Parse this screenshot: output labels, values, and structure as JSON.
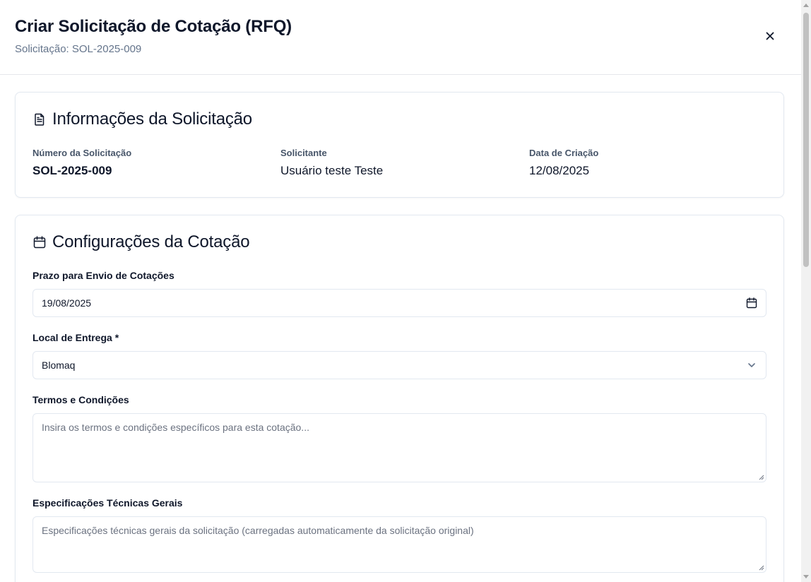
{
  "header": {
    "title": "Criar Solicitação de Cotação (RFQ)",
    "subtitle": "Solicitação: SOL-2025-009",
    "close_icon": "close-icon"
  },
  "info_card": {
    "icon": "document-icon",
    "title": "Informações da Solicitação",
    "fields": [
      {
        "label": "Número da Solicitação",
        "value": "SOL-2025-009"
      },
      {
        "label": "Solicitante",
        "value": "Usuário teste Teste"
      },
      {
        "label": "Data de Criação",
        "value": "12/08/2025"
      }
    ]
  },
  "config_card": {
    "icon": "calendar-icon",
    "title": "Configurações da Cotação",
    "deadline": {
      "label": "Prazo para Envio de Cotações",
      "value": "19/08/2025",
      "icon": "calendar-icon"
    },
    "delivery": {
      "label": "Local de Entrega *",
      "value": "Blomaq",
      "icon": "chevron-down-icon"
    },
    "terms": {
      "label": "Termos e Condições",
      "placeholder": "Insira os termos e condições específicos para esta cotação..."
    },
    "specs": {
      "label": "Especificações Técnicas Gerais",
      "placeholder": "Especificações técnicas gerais da solicitação (carregadas automaticamente da solicitação original)"
    }
  }
}
